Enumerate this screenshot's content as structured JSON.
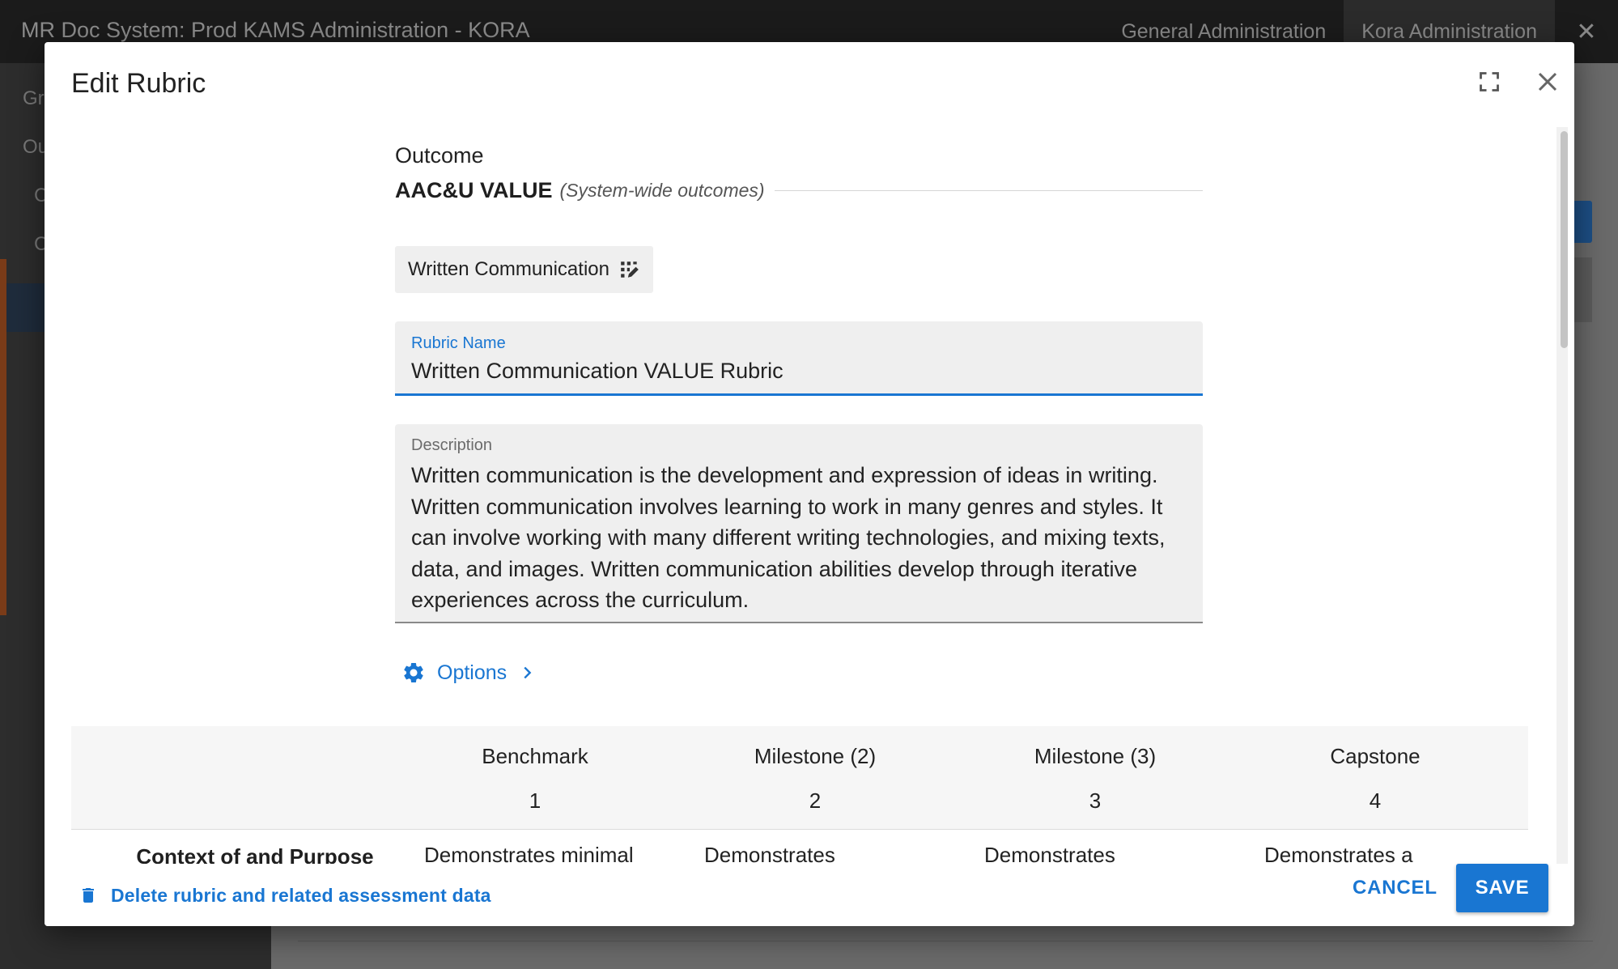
{
  "app": {
    "title": "MR Doc System: Prod KAMS Administration - KORA",
    "nav": [
      "General Administration",
      "Kora Administration"
    ],
    "left_items": [
      "Gr",
      "Ou",
      "C",
      "C"
    ]
  },
  "dialog": {
    "title": "Edit Rubric",
    "outcome_label": "Outcome",
    "outcome_name": "AAC&U VALUE",
    "outcome_scope": "(System-wide outcomes)",
    "chip_label": "Written Communication",
    "rubric_name": {
      "label": "Rubric Name",
      "value": "Written Communication VALUE Rubric"
    },
    "description": {
      "label": "Description",
      "value": "Written communication is the development and expression of ideas in writing. Written communication involves learning to work in many genres and styles. It can involve working with many different writing technologies, and mixing texts, data, and images. Written communication abilities develop through iterative experiences across the curriculum."
    },
    "options_label": "Options",
    "rubric": {
      "levels": [
        {
          "name": "Benchmark",
          "score": "1"
        },
        {
          "name": "Milestone (2)",
          "score": "2"
        },
        {
          "name": "Milestone (3)",
          "score": "3"
        },
        {
          "name": "Capstone",
          "score": "4"
        }
      ],
      "rows": [
        {
          "criterion": "Context of and Purpose",
          "cells": [
            "Demonstrates minimal",
            "Demonstrates",
            "Demonstrates",
            "Demonstrates a"
          ]
        }
      ]
    },
    "footer": {
      "delete_label": "Delete rubric and related assessment data",
      "cancel_label": "CANCEL",
      "save_label": "SAVE"
    }
  },
  "colors": {
    "accent": "#1976d2",
    "field_bg": "#efefef"
  }
}
